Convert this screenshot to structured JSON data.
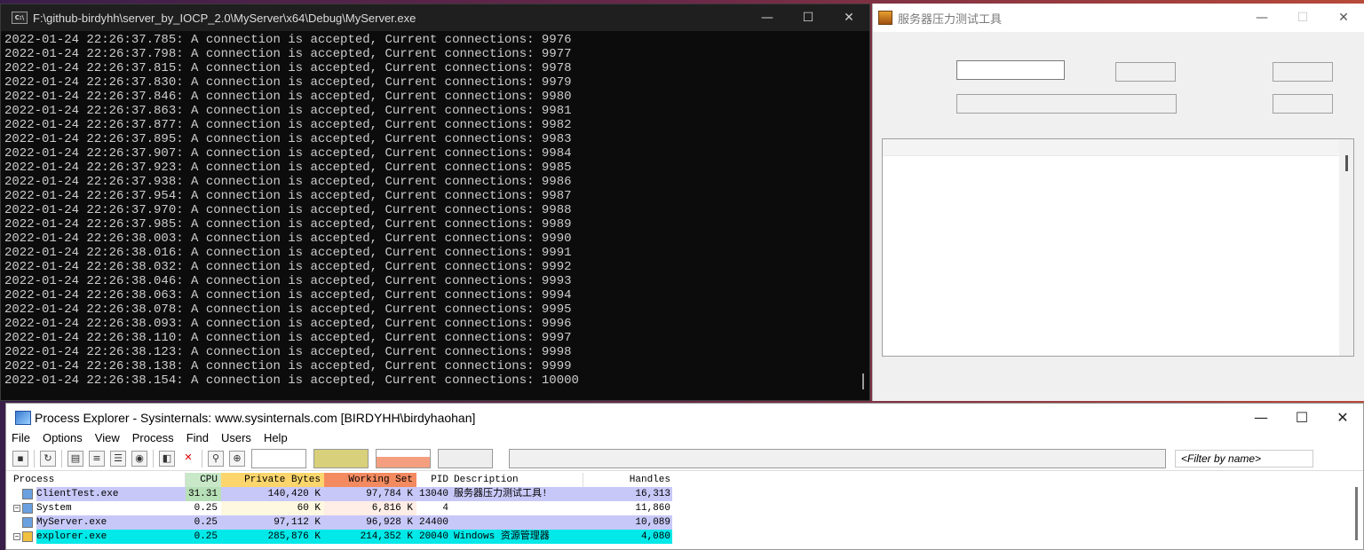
{
  "console": {
    "title": "F:\\github-birdyhh\\server_by_IOCP_2.0\\MyServer\\x64\\Debug\\MyServer.exe",
    "icon_text": "C:\\",
    "lines": [
      "2022-01-24 22:26:37.785: A connection is accepted, Current connections: 9976",
      "2022-01-24 22:26:37.798: A connection is accepted, Current connections: 9977",
      "2022-01-24 22:26:37.815: A connection is accepted, Current connections: 9978",
      "2022-01-24 22:26:37.830: A connection is accepted, Current connections: 9979",
      "2022-01-24 22:26:37.846: A connection is accepted, Current connections: 9980",
      "2022-01-24 22:26:37.863: A connection is accepted, Current connections: 9981",
      "2022-01-24 22:26:37.877: A connection is accepted, Current connections: 9982",
      "2022-01-24 22:26:37.895: A connection is accepted, Current connections: 9983",
      "2022-01-24 22:26:37.907: A connection is accepted, Current connections: 9984",
      "2022-01-24 22:26:37.923: A connection is accepted, Current connections: 9985",
      "2022-01-24 22:26:37.938: A connection is accepted, Current connections: 9986",
      "2022-01-24 22:26:37.954: A connection is accepted, Current connections: 9987",
      "2022-01-24 22:26:37.970: A connection is accepted, Current connections: 9988",
      "2022-01-24 22:26:37.985: A connection is accepted, Current connections: 9989",
      "2022-01-24 22:26:38.003: A connection is accepted, Current connections: 9990",
      "2022-01-24 22:26:38.016: A connection is accepted, Current connections: 9991",
      "2022-01-24 22:26:38.032: A connection is accepted, Current connections: 9992",
      "2022-01-24 22:26:38.046: A connection is accepted, Current connections: 9993",
      "2022-01-24 22:26:38.063: A connection is accepted, Current connections: 9994",
      "2022-01-24 22:26:38.078: A connection is accepted, Current connections: 9995",
      "2022-01-24 22:26:38.093: A connection is accepted, Current connections: 9996",
      "2022-01-24 22:26:38.110: A connection is accepted, Current connections: 9997",
      "2022-01-24 22:26:38.123: A connection is accepted, Current connections: 9998",
      "2022-01-24 22:26:38.138: A connection is accepted, Current connections: 9999",
      "2022-01-24 22:26:38.154: A connection is accepted, Current connections: 10000"
    ],
    "minimize": "—",
    "maximize": "☐",
    "close": "✕"
  },
  "stress_tool": {
    "title": "服务器压力测试工具",
    "minimize": "—",
    "maximize": "☐",
    "close": "✕"
  },
  "procexp": {
    "title": "Process Explorer - Sysinternals: www.sysinternals.com [BIRDYHH\\birdyhaohan]",
    "minimize": "—",
    "maximize": "☐",
    "close": "✕",
    "menu": [
      "File",
      "Options",
      "View",
      "Process",
      "Find",
      "Users",
      "Help"
    ],
    "filter_placeholder": "<Filter by name>",
    "columns": {
      "process": "Process",
      "cpu": "CPU",
      "private_bytes": "Private Bytes",
      "working_set": "Working Set",
      "pid": "PID",
      "description": "Description",
      "handles": "Handles"
    },
    "rows": [
      {
        "name": "ClientTest.exe",
        "cpu": "31.31",
        "private": "140,420 K",
        "ws": "97,784 K",
        "pid": "13040",
        "desc": "服务器压力测试工具!",
        "handles": "16,313",
        "color": "#c8c8f8",
        "expand": ""
      },
      {
        "name": "System",
        "cpu": "0.25",
        "private": "60 K",
        "ws": "6,816 K",
        "pid": "4",
        "desc": "",
        "handles": "11,860",
        "color": "#ffffff",
        "expand": "−"
      },
      {
        "name": "MyServer.exe",
        "cpu": "0.25",
        "private": "97,112 K",
        "ws": "96,928 K",
        "pid": "24400",
        "desc": "",
        "handles": "10,089",
        "color": "#c8c8f8",
        "expand": ""
      },
      {
        "name": "explorer.exe",
        "cpu": "0.25",
        "private": "285,876 K",
        "ws": "214,352 K",
        "pid": "20040",
        "desc": "Windows 资源管理器",
        "handles": "4,080",
        "color": "#00e8e8",
        "expand": "−"
      }
    ]
  }
}
